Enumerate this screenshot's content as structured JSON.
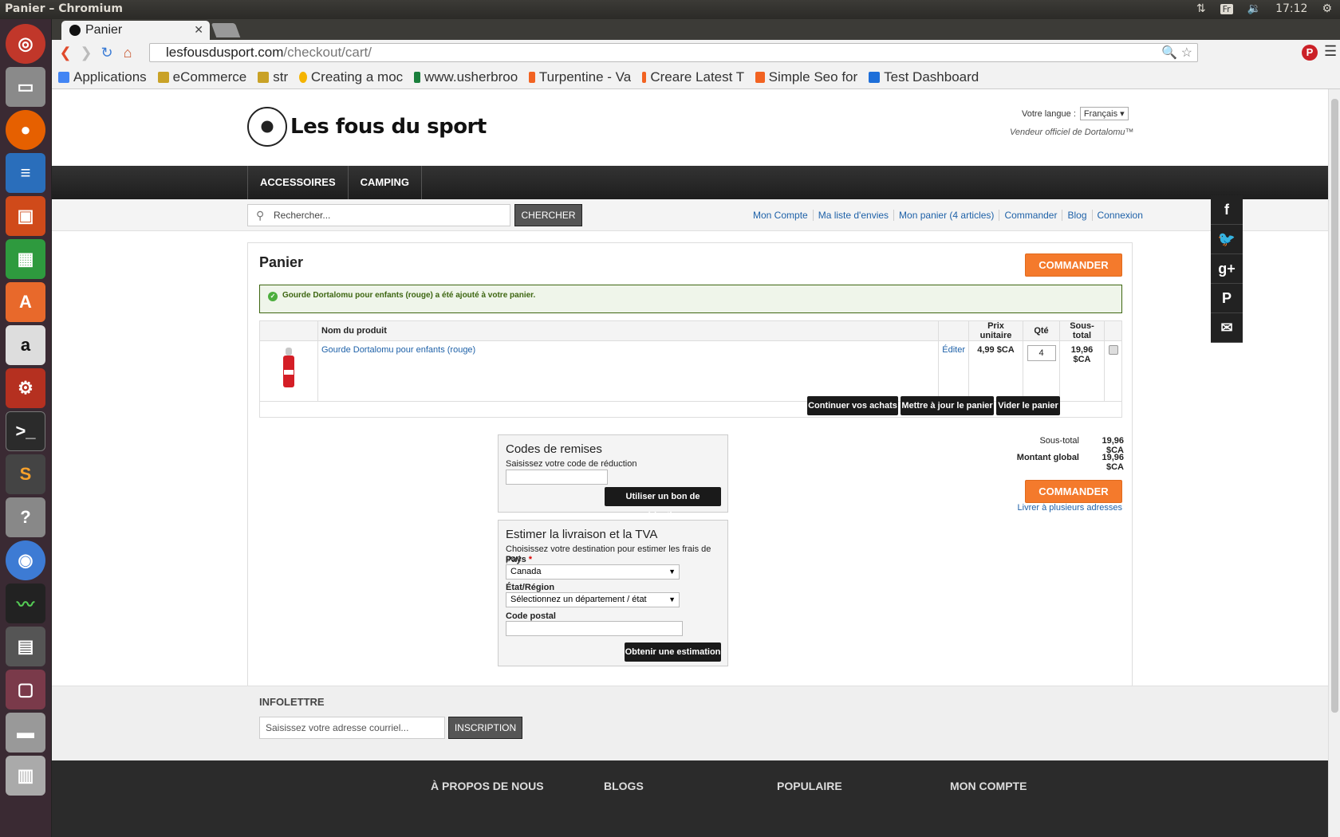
{
  "os": {
    "window_title": "Panier – Chromium",
    "keyboard_layout": "Fr",
    "clock": "17:12"
  },
  "browser": {
    "tab_title": "Panier",
    "url_host": "lesfousdusport.com",
    "url_path": "/checkout/cart/",
    "bookmarks": [
      {
        "label": "Applications",
        "color": "#4285f4"
      },
      {
        "label": "eCommerce",
        "color": "#c9a227"
      },
      {
        "label": "str",
        "color": "#c9a227"
      },
      {
        "label": "Creating a moc",
        "color": "#f5b400"
      },
      {
        "label": "www.usherbroo",
        "color": "#1a7f3c"
      },
      {
        "label": "Turpentine - Va",
        "color": "#f26322"
      },
      {
        "label": "Creare Latest T",
        "color": "#f26322"
      },
      {
        "label": "Simple Seo for",
        "color": "#f26322"
      },
      {
        "label": "Test Dashboard",
        "color": "#1e6fd9"
      }
    ]
  },
  "site": {
    "logo_text": "Les fous du sport",
    "language_label": "Votre langue :",
    "language_value": "Français",
    "tagline": "Vendeur officiel de Dortalomu™",
    "nav": [
      "ACCESSOIRES",
      "CAMPING"
    ],
    "search_placeholder": "Rechercher...",
    "search_button": "CHERCHER",
    "top_links": [
      "Mon Compte",
      "Ma liste d'envies",
      "Mon panier (4 articles)",
      "Commander",
      "Blog",
      "Connexion"
    ]
  },
  "cart": {
    "title": "Panier",
    "checkout_button": "COMMANDER",
    "success_message": "Gourde Dortalomu pour enfants (rouge) a été ajouté à votre panier.",
    "headers": {
      "product": "Nom du produit",
      "unit_price": "Prix unitaire",
      "qty": "Qté",
      "subtotal": "Sous-total"
    },
    "item": {
      "name": "Gourde Dortalomu pour enfants (rouge)",
      "edit": "Éditer",
      "unit_price": "4,99 $CA",
      "qty": "4",
      "subtotal": "19,96 $CA"
    },
    "continue_button": "Continuer vos achats",
    "update_button": "Mettre à jour le panier",
    "empty_button": "Vider le panier",
    "discount": {
      "title": "Codes de remises",
      "label": "Saisissez votre code de réduction",
      "button": "Utiliser un bon de réduction"
    },
    "shipping": {
      "title": "Estimer la livraison et la TVA",
      "intro": "Choisissez votre destination pour estimer les frais de port",
      "country_label": "Pays",
      "country_value": "Canada",
      "region_label": "État/Région",
      "region_value": "Sélectionnez un département / état",
      "zip_label": "Code postal",
      "button": "Obtenir une estimation"
    },
    "totals": {
      "subtotal_label": "Sous-total",
      "subtotal_value": "19,96 $CA",
      "grand_label": "Montant global",
      "grand_value": "19,96 $CA"
    },
    "multi_address": "Livrer à plusieurs adresses"
  },
  "footer": {
    "newsletter_title": "INFOLETTRE",
    "newsletter_placeholder": "Saisissez votre adresse courriel...",
    "newsletter_button": "INSCRIPTION",
    "columns": [
      "À PROPOS DE NOUS",
      "BLOGS",
      "POPULAIRE",
      "MON COMPTE"
    ]
  }
}
